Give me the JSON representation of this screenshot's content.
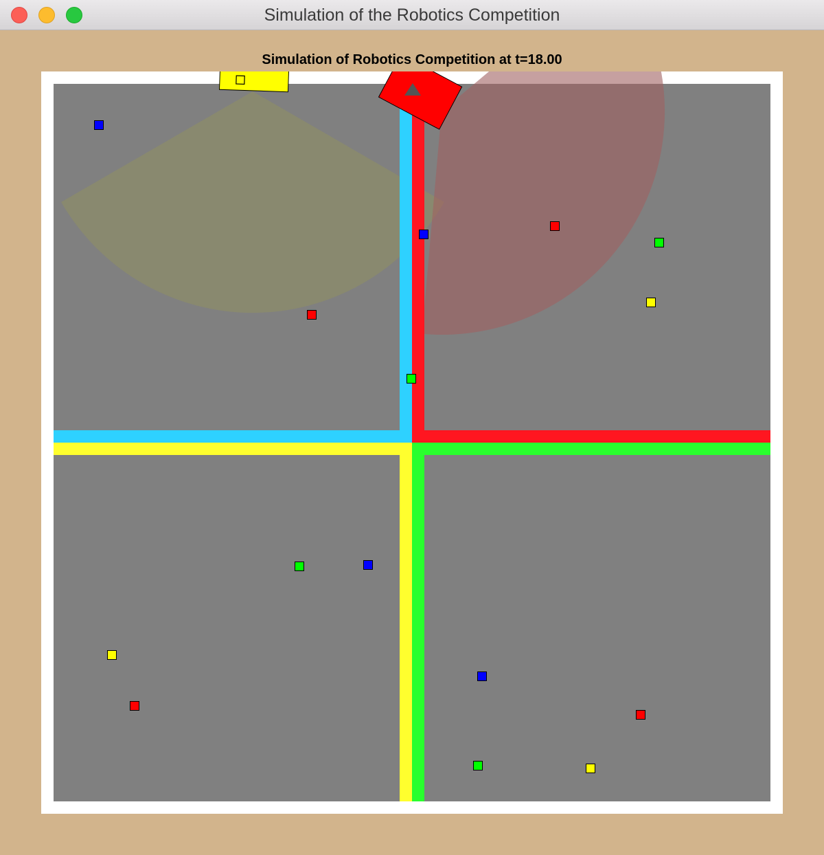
{
  "window": {
    "title": "Simulation of the Robotics Competition",
    "buttons": [
      "close",
      "minimize",
      "zoom"
    ]
  },
  "plot": {
    "title": "Simulation of Robotics Competition at t=18.00"
  },
  "colors": {
    "window_background": "#d2b48c",
    "frame": "#ffffff",
    "field": "#808080",
    "lane_cyan": "#2ed1ff",
    "lane_red": "#ff1620",
    "lane_yellow": "#ffff2e",
    "lane_green": "#29ff2e",
    "robot_red": "#ff0000",
    "robot_yellow": "#ffff00",
    "sensor_yellow": "#909060",
    "sensor_red": "#a06060"
  },
  "robots": [
    {
      "team": "red",
      "color": "#ff0000",
      "marker": "triangle",
      "sensor_color": "#a06060"
    },
    {
      "team": "yellow",
      "color": "#ffff00",
      "marker": "hollow-square",
      "sensor_color": "#909060"
    }
  ],
  "tokens": [
    {
      "color": "#0000ff"
    },
    {
      "color": "#0000ff"
    },
    {
      "color": "#ff0000"
    },
    {
      "color": "#00ff00"
    },
    {
      "color": "#ffff00"
    },
    {
      "color": "#ff0000"
    },
    {
      "color": "#00ff00"
    },
    {
      "color": "#00ff00"
    },
    {
      "color": "#0000ff"
    },
    {
      "color": "#ffff00"
    },
    {
      "color": "#ff0000"
    },
    {
      "color": "#0000ff"
    },
    {
      "color": "#ff0000"
    },
    {
      "color": "#00ff00"
    },
    {
      "color": "#ffff00"
    }
  ]
}
